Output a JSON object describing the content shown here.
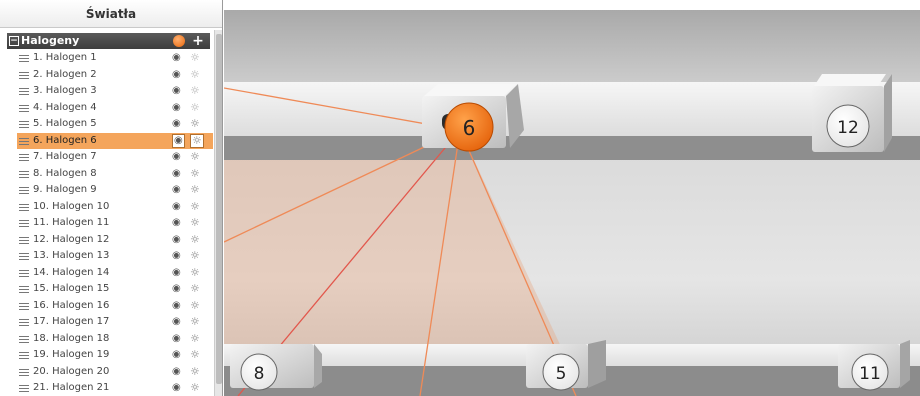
{
  "panel": {
    "title": "Światła",
    "group": {
      "name": "Halogeny",
      "collapse_glyph": "−",
      "add_glyph": "+"
    },
    "items": [
      {
        "label": "1. Halogen 1",
        "light_on": false,
        "selected": false
      },
      {
        "label": "2. Halogen 2",
        "light_on": false,
        "selected": false
      },
      {
        "label": "3. Halogen 3",
        "light_on": false,
        "selected": false
      },
      {
        "label": "4. Halogen 4",
        "light_on": false,
        "selected": false
      },
      {
        "label": "5. Halogen 5",
        "light_on": true,
        "selected": false
      },
      {
        "label": "6. Halogen 6",
        "light_on": true,
        "selected": true
      },
      {
        "label": "7. Halogen 7",
        "light_on": true,
        "selected": false
      },
      {
        "label": "8. Halogen 8",
        "light_on": true,
        "selected": false
      },
      {
        "label": "9. Halogen 9",
        "light_on": true,
        "selected": false
      },
      {
        "label": "10. Halogen 10",
        "light_on": true,
        "selected": false
      },
      {
        "label": "11. Halogen 11",
        "light_on": true,
        "selected": false
      },
      {
        "label": "12. Halogen 12",
        "light_on": true,
        "selected": false
      },
      {
        "label": "13. Halogen 13",
        "light_on": true,
        "selected": false
      },
      {
        "label": "14. Halogen 14",
        "light_on": true,
        "selected": false
      },
      {
        "label": "15. Halogen 15",
        "light_on": true,
        "selected": false
      },
      {
        "label": "16. Halogen 16",
        "light_on": true,
        "selected": false
      },
      {
        "label": "17. Halogen 17",
        "light_on": true,
        "selected": false
      },
      {
        "label": "18. Halogen 18",
        "light_on": true,
        "selected": false
      },
      {
        "label": "19. Halogen 19",
        "light_on": true,
        "selected": false
      },
      {
        "label": "20. Halogen 20",
        "light_on": true,
        "selected": false
      },
      {
        "label": "21. Halogen 21",
        "light_on": true,
        "selected": false
      }
    ],
    "icons": {
      "visibility": "eye-icon",
      "light": "sun-icon",
      "drag": "drag-handle-icon"
    }
  },
  "viewport": {
    "markers": [
      {
        "label": "6",
        "active": true
      },
      {
        "label": "12",
        "active": false
      },
      {
        "label": "8",
        "active": false
      },
      {
        "label": "5",
        "active": false
      },
      {
        "label": "11",
        "active": false
      }
    ],
    "colors": {
      "accent": "#f07a1e",
      "beam": "#ef8a57",
      "beam_red": "#e2574c",
      "selection": "#f4a55c"
    }
  }
}
